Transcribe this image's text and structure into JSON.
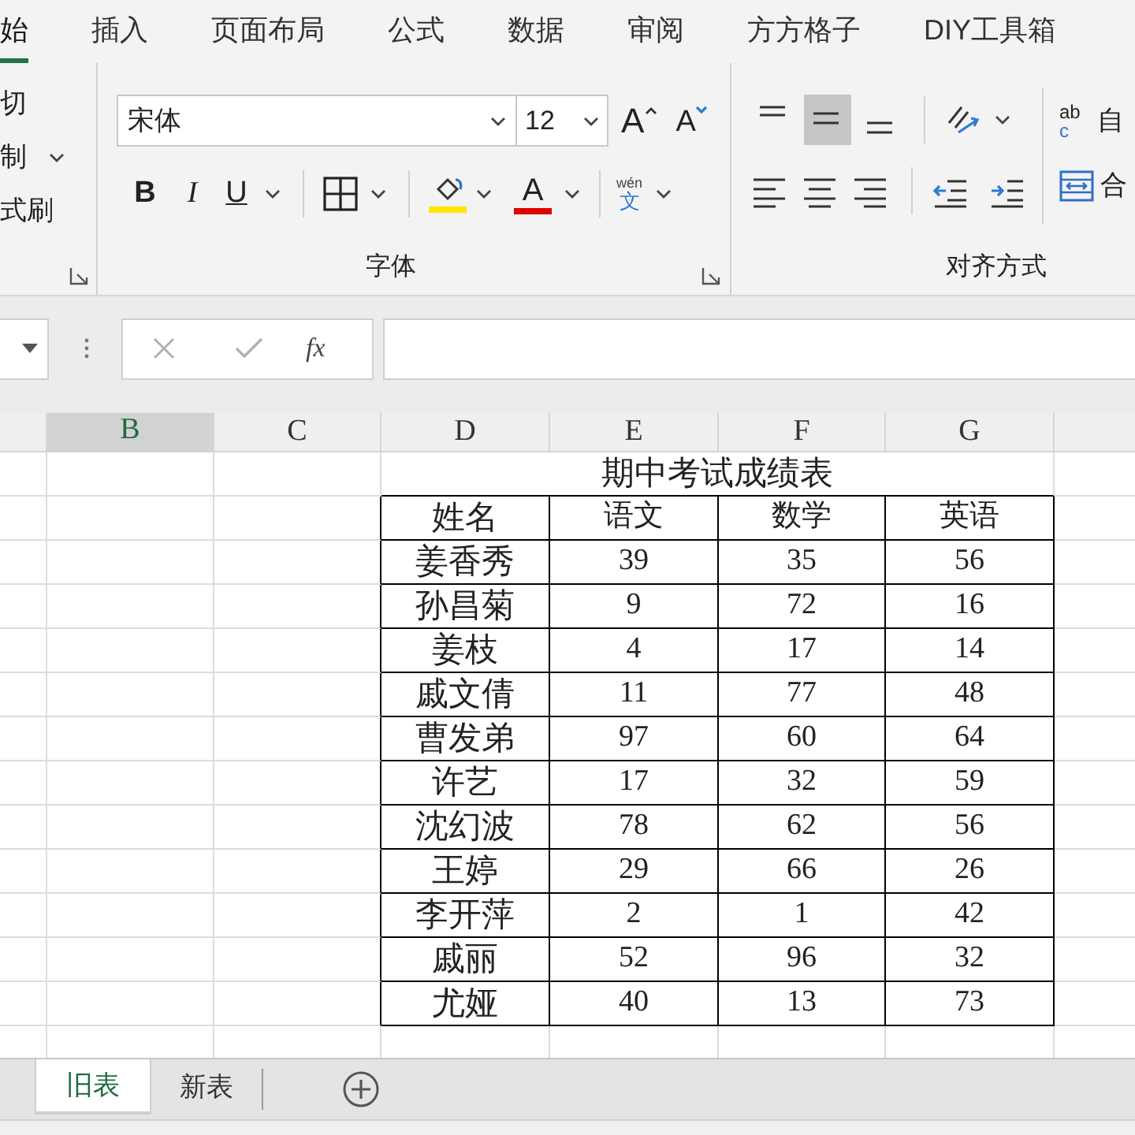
{
  "ribbon_tabs": [
    {
      "label": "始",
      "selected": true
    },
    {
      "label": "插入",
      "selected": false
    },
    {
      "label": "页面布局",
      "selected": false
    },
    {
      "label": "公式",
      "selected": false
    },
    {
      "label": "数据",
      "selected": false
    },
    {
      "label": "审阅",
      "selected": false
    },
    {
      "label": "方方格子",
      "selected": false
    },
    {
      "label": "DIY工具箱",
      "selected": false
    }
  ],
  "clipboard": {
    "items": [
      "切",
      "制",
      "式刷"
    ]
  },
  "font_group": {
    "font_name": "宋体",
    "font_size": "12",
    "grow_button": "A",
    "shrink_button": "A",
    "bold": "B",
    "italic": "I",
    "underline": "U",
    "font_color": "A",
    "phonetic_top": "wén",
    "phonetic_bottom": "文",
    "label": "字体"
  },
  "alignment_group": {
    "vertical_align": [
      {
        "selected": false
      },
      {
        "selected": true
      },
      {
        "selected": false
      }
    ],
    "wrap_icon_top": "ab",
    "wrap_icon_bottom": "c",
    "wrap_text": "自",
    "merge": "合",
    "label": "对齐方式"
  },
  "formula_bar": {
    "function_button": "fx"
  },
  "column_headers": [
    {
      "label": "B",
      "selected": true
    },
    {
      "label": "C",
      "selected": false
    },
    {
      "label": "D",
      "selected": false
    },
    {
      "label": "E",
      "selected": false
    },
    {
      "label": "F",
      "selected": false
    },
    {
      "label": "G",
      "selected": false
    }
  ],
  "sheet": {
    "title": "期中考试成绩表",
    "header": [
      "姓名",
      "语文",
      "数学",
      "英语"
    ],
    "rows": [
      [
        "姜香秀",
        "39",
        "35",
        "56"
      ],
      [
        "孙昌菊",
        "9",
        "72",
        "16"
      ],
      [
        "姜枝",
        "4",
        "17",
        "14"
      ],
      [
        "戚文倩",
        "11",
        "77",
        "48"
      ],
      [
        "曹发弟",
        "97",
        "60",
        "64"
      ],
      [
        "许艺",
        "17",
        "32",
        "59"
      ],
      [
        "沈幻波",
        "78",
        "62",
        "56"
      ],
      [
        "王婷",
        "29",
        "66",
        "26"
      ],
      [
        "李开萍",
        "2",
        "1",
        "42"
      ],
      [
        "戚丽",
        "52",
        "96",
        "32"
      ],
      [
        "尤娅",
        "40",
        "13",
        "73"
      ]
    ]
  },
  "sheet_tabs": [
    {
      "label": "旧表",
      "selected": true
    },
    {
      "label": "新表",
      "selected": false
    }
  ]
}
